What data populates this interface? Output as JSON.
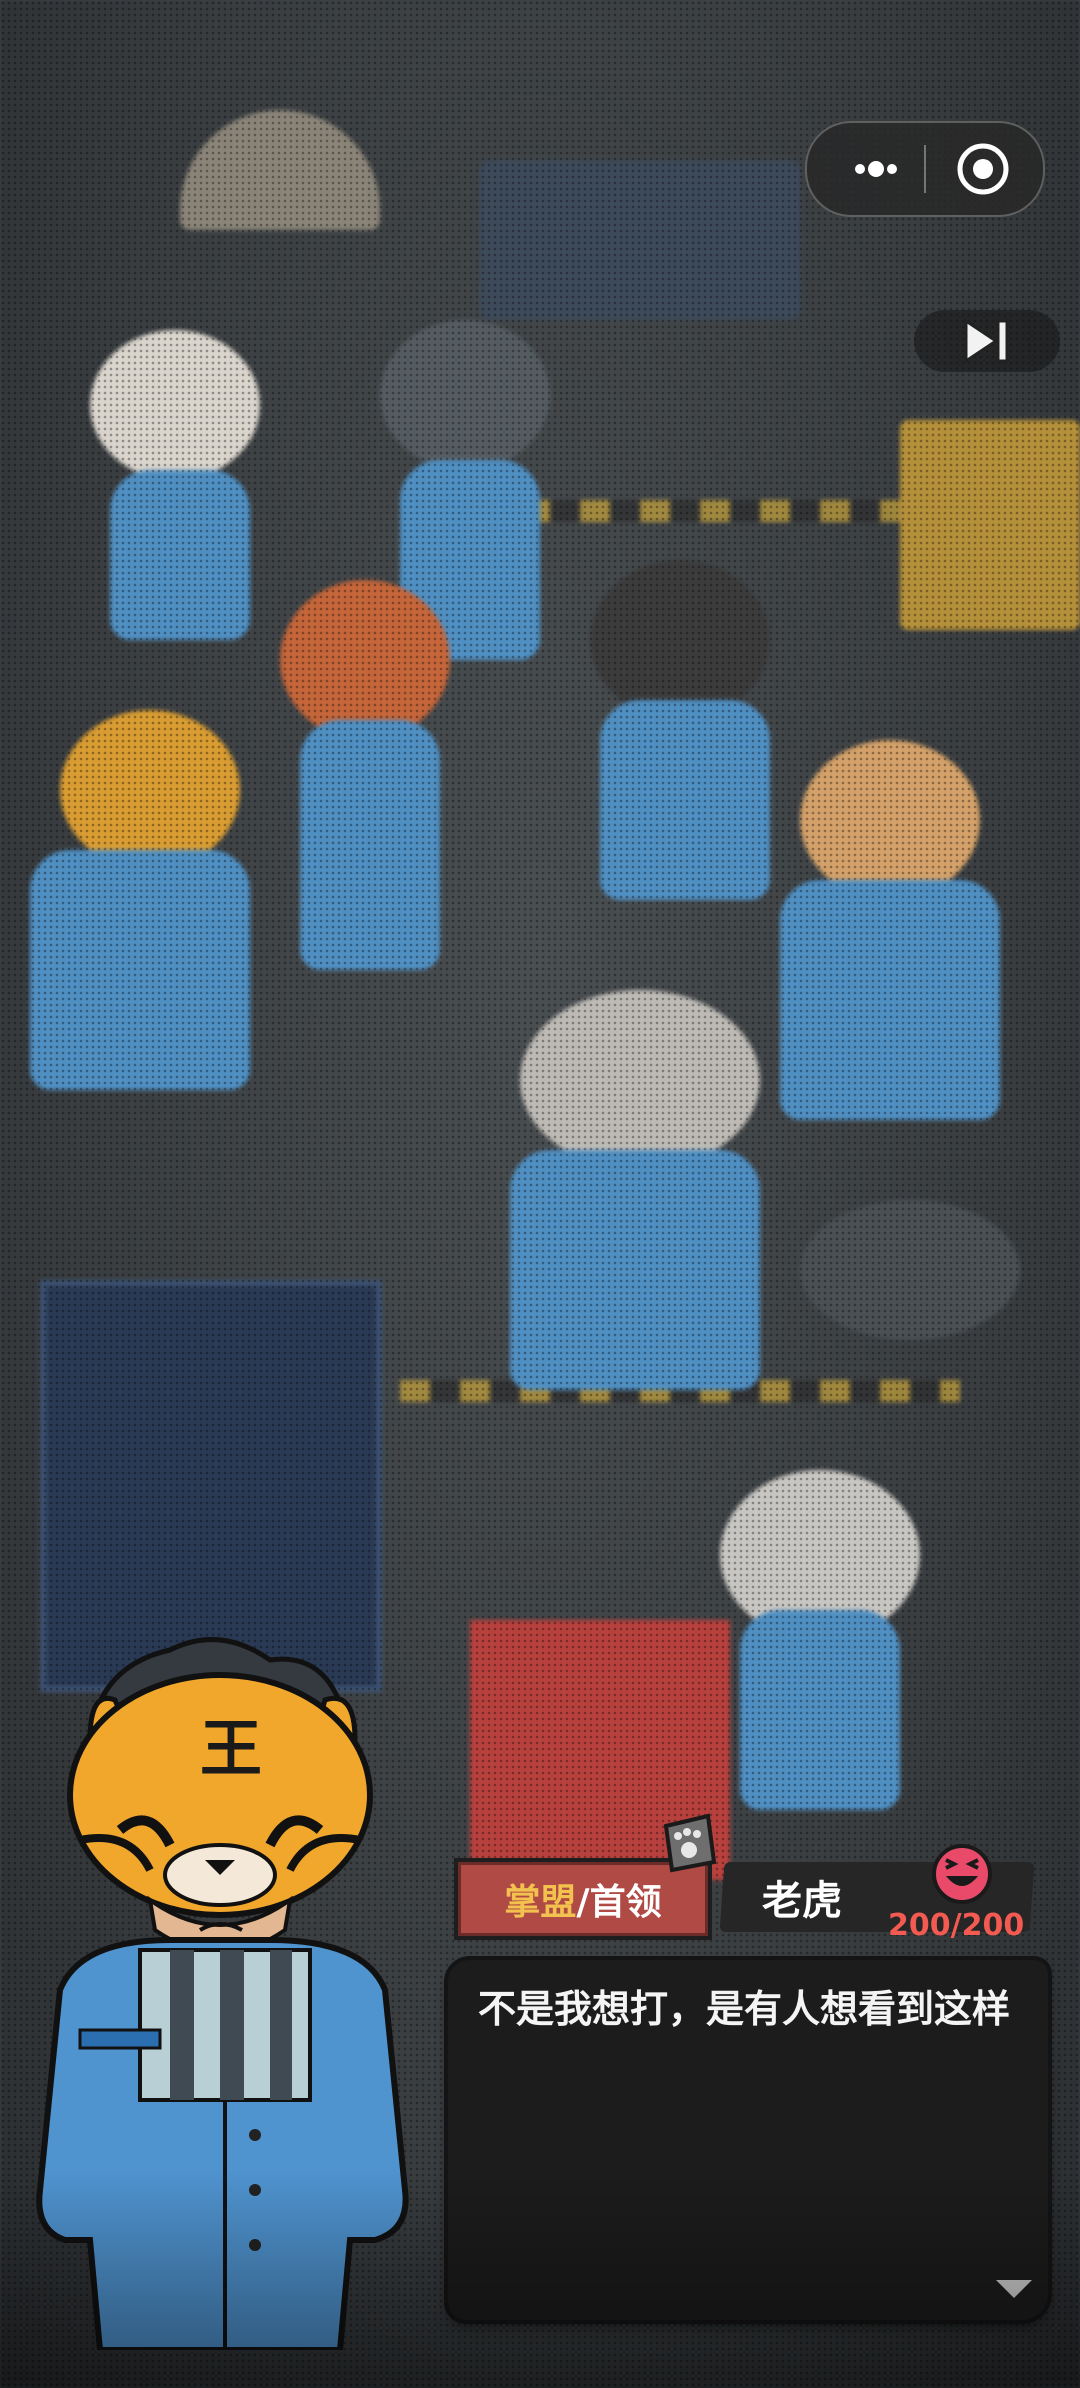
{
  "window": {
    "menu_icon": "more-dots-icon",
    "close_icon": "target-circle-icon"
  },
  "controls": {
    "skip_icon": "skip-forward-icon"
  },
  "speaker": {
    "role_highlight": "掌盟",
    "role_rest": "/首领",
    "name": "老虎",
    "mood_icon": "laughing-face-icon",
    "hp": "200/200"
  },
  "dialogue": {
    "text": "不是我想打，是有人想看到这样",
    "next_icon": "triangle-down-icon"
  },
  "colors": {
    "accent_red": "#b04a44",
    "accent_gold": "#f2c14e",
    "hp_red": "#f25a52",
    "uniform_blue": "#4f8fc2"
  }
}
